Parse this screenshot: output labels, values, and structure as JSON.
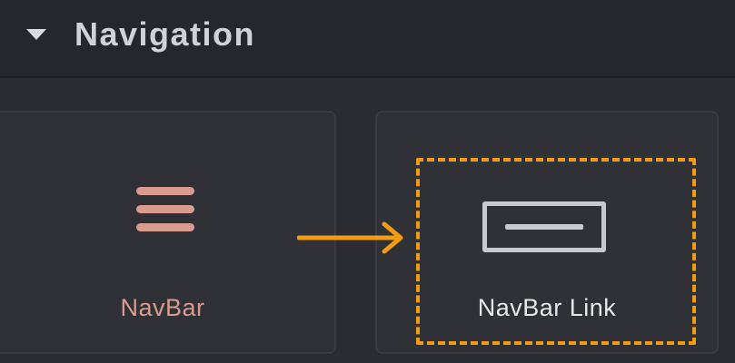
{
  "section": {
    "title": "Navigation",
    "collapse_icon": "caret-down-icon"
  },
  "widgets": [
    {
      "label": "NavBar",
      "icon": "hamburger-menu-icon",
      "accent_color": "#d99c8e"
    },
    {
      "label": "NavBar Link",
      "icon": "link-box-icon",
      "accent_color": "#c8cacf"
    }
  ],
  "annotation": {
    "highlight_color": "#f39c12",
    "arrow_icon": "right-arrow-icon"
  }
}
